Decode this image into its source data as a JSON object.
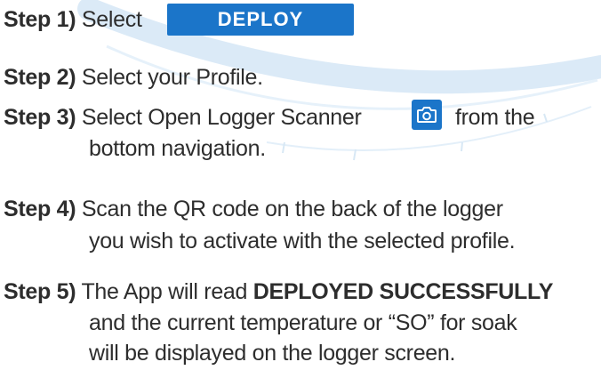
{
  "step1": {
    "label": "Step 1)",
    "text": "Select",
    "button_label": "DEPLOY"
  },
  "step2": {
    "label": "Step 2)",
    "text": "Select your Profile."
  },
  "step3": {
    "label": "Step 3)",
    "text_before": "Select Open Logger Scanner",
    "text_after": "from the",
    "line2": "bottom navigation.",
    "icon": "camera-icon"
  },
  "step4": {
    "label": "Step 4)",
    "line1": "Scan the QR code on the back of the logger",
    "line2": "you wish to activate with the selected profile."
  },
  "step5": {
    "label": "Step 5)",
    "line1_before": "The App will read",
    "line1_bold": "DEPLOYED SUCCESSFULLY",
    "line2": "and the current temperature or “SO” for soak",
    "line3": "will be displayed on the logger screen."
  },
  "colors": {
    "accent": "#1b75c9",
    "text": "#2d2d2d",
    "arc": "#d6eaf6"
  }
}
